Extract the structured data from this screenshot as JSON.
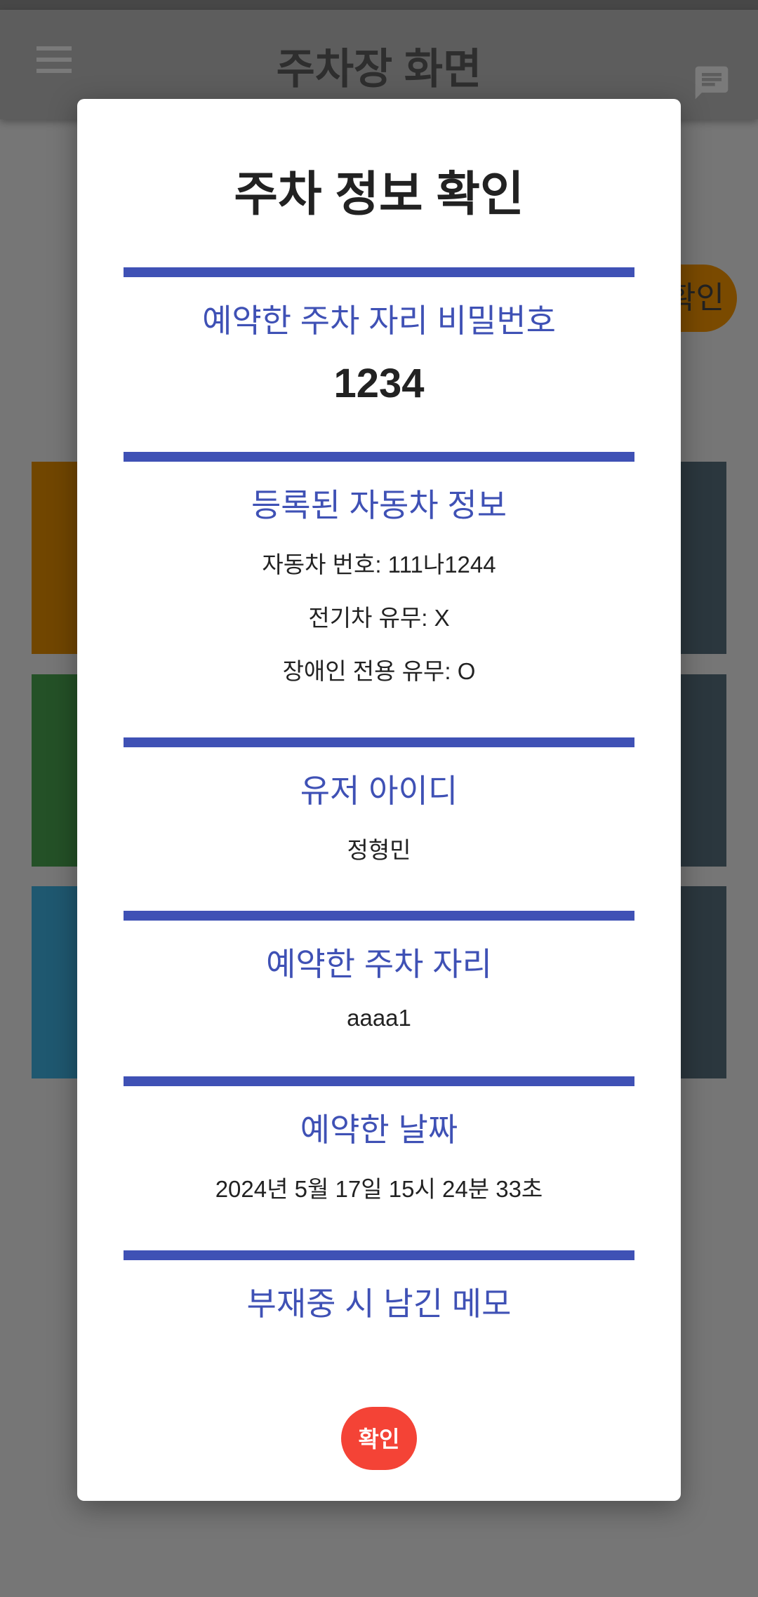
{
  "appbar": {
    "title": "주차장 화면",
    "menu_icon": "hamburger-menu-icon",
    "chat_icon": "chat-message-icon"
  },
  "background": {
    "pill_label": "확인",
    "tile_colors": [
      "#714600",
      "#245127",
      "#1f5870",
      "#2b373e"
    ]
  },
  "modal": {
    "title": "주차 정보 확인",
    "accent_color": "#3f51b5",
    "sections": [
      {
        "title": "예약한 주차 자리 비밀번호",
        "value": "1234"
      },
      {
        "title": "등록된 자동차 정보",
        "lines": [
          "자동차 번호: 111나1244",
          "전기차 유무: X",
          "장애인 전용 유무: O"
        ]
      },
      {
        "title": "유저 아이디",
        "value": "정형민"
      },
      {
        "title": "예약한 주차 자리",
        "value": "aaaa1"
      },
      {
        "title": "예약한 날짜",
        "value": "2024년 5월 17일 15시 24분 33초"
      },
      {
        "title": "부재중 시 남긴 메모",
        "value": ""
      }
    ],
    "confirm_label": "확인",
    "confirm_color": "#f44336"
  }
}
